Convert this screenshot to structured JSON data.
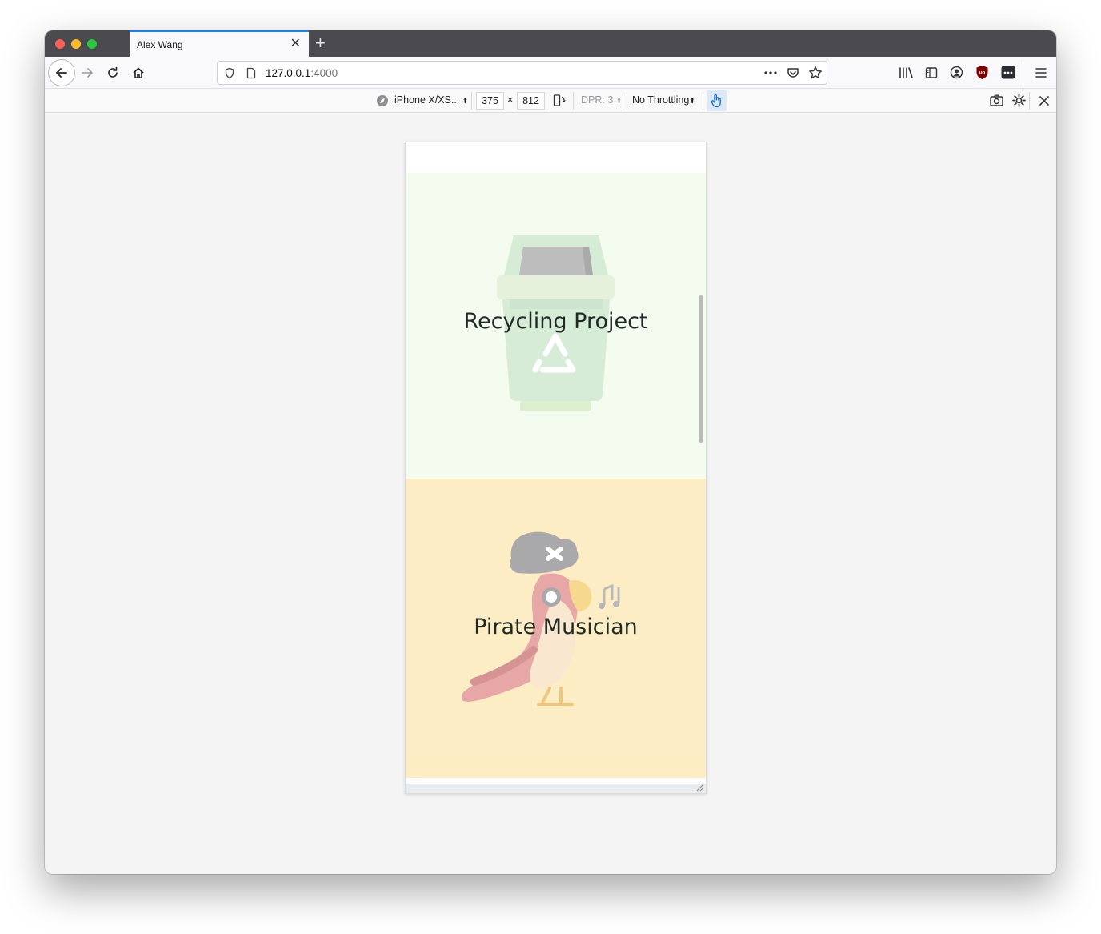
{
  "browser": {
    "tab_title": "Alex Wang",
    "tab_close": "✕",
    "new_tab": "+",
    "url_host": "127.0.0.1",
    "url_port": ":4000"
  },
  "rdm": {
    "device": "iPhone X/XS...",
    "width": "375",
    "times": "×",
    "height": "812",
    "dpr": "DPR: 3",
    "throttling": "No Throttling"
  },
  "page": {
    "cards": [
      {
        "title": "Recycling Project",
        "icon": "recycle-bin-icon"
      },
      {
        "title": "Pirate Musician",
        "icon": "pirate-parrot-icon"
      }
    ]
  }
}
